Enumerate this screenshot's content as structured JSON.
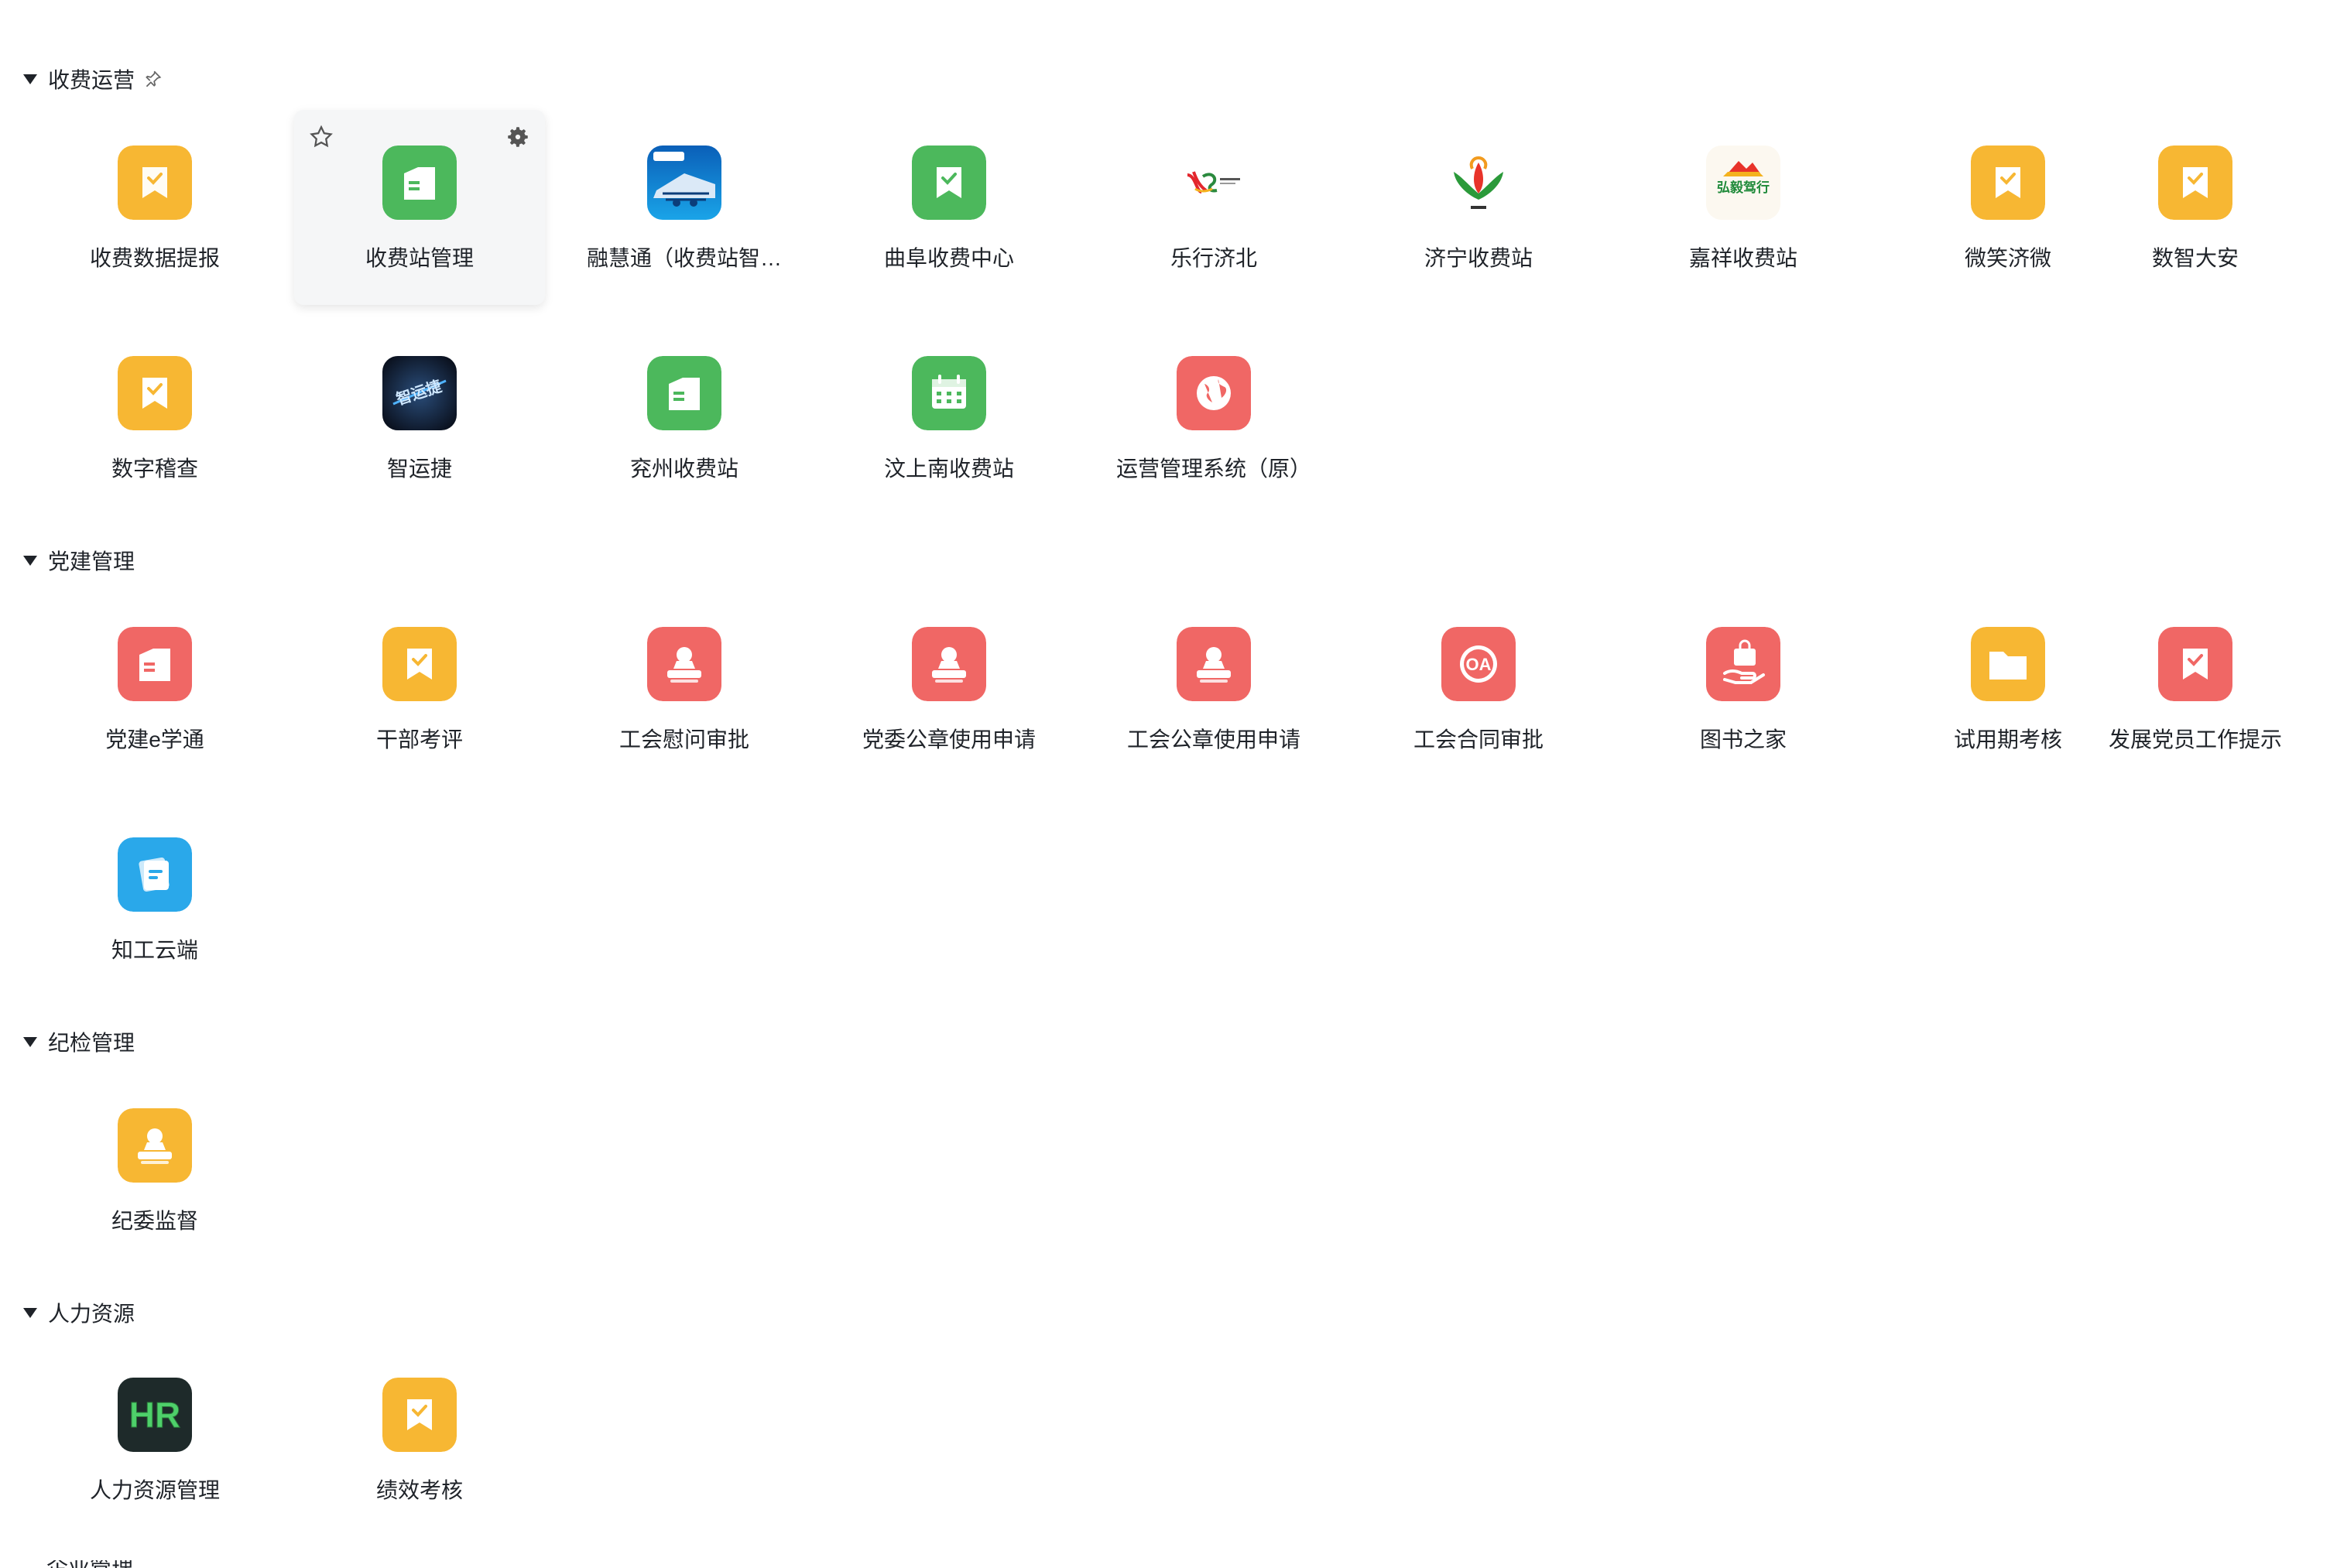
{
  "colors": {
    "orange": "#f7b733",
    "green": "#4cb85c",
    "red": "#f06765",
    "blue": "#2aa8ea",
    "text": "#1f2329"
  },
  "sections": [
    {
      "title": "收费运营",
      "pinned": true,
      "apps": [
        {
          "label": "收费数据提报",
          "icon": "orange-bookmark-check-icon"
        },
        {
          "label": "收费站管理",
          "icon": "green-document-icon"
        },
        {
          "label": "融慧通（收费站智…",
          "icon": "toll-station-photo-icon"
        },
        {
          "label": "曲阜收费中心",
          "icon": "green-bookmark-check-icon"
        },
        {
          "label": "乐行济北",
          "icon": "lexing-jibei-logo-icon"
        },
        {
          "label": "济宁收费站",
          "icon": "jining-flower-logo-icon"
        },
        {
          "label": "嘉祥收费站",
          "icon": "hongyi-logo-icon"
        },
        {
          "label": "微笑济微",
          "icon": "orange-bookmark-check-icon"
        },
        {
          "label": "数智大安",
          "icon": "orange-bookmark-check-icon"
        },
        {
          "label": "数字稽查",
          "icon": "orange-bookmark-check-icon"
        },
        {
          "label": "智运捷",
          "icon": "zhiyunjie-dark-logo-icon"
        },
        {
          "label": "兖州收费站",
          "icon": "green-document-icon"
        },
        {
          "label": "汶上南收费站",
          "icon": "green-calendar-icon"
        },
        {
          "label": "运营管理系统（原）",
          "icon": "red-globe-icon"
        }
      ]
    },
    {
      "title": "党建管理",
      "pinned": false,
      "apps": [
        {
          "label": "党建e学通",
          "icon": "red-document-icon"
        },
        {
          "label": "干部考评",
          "icon": "orange-bookmark-check-icon"
        },
        {
          "label": "工会慰问审批",
          "icon": "red-stamp-icon"
        },
        {
          "label": "党委公章使用申请",
          "icon": "red-stamp-icon"
        },
        {
          "label": "工会公章使用申请",
          "icon": "red-stamp-icon"
        },
        {
          "label": "工会合同审批",
          "icon": "red-oa-icon"
        },
        {
          "label": "图书之家",
          "icon": "red-hand-bag-icon"
        },
        {
          "label": "试用期考核",
          "icon": "orange-folder-icon"
        },
        {
          "label": "发展党员工作提示",
          "icon": "red-bookmark-check-icon"
        },
        {
          "label": "知工云端",
          "icon": "blue-notes-icon"
        }
      ]
    },
    {
      "title": "纪检管理",
      "pinned": false,
      "apps": [
        {
          "label": "纪委监督",
          "icon": "orange-stamp-icon"
        }
      ]
    },
    {
      "title": "人力资源",
      "pinned": false,
      "apps": [
        {
          "label": "人力资源管理",
          "icon": "hr-logo-icon"
        },
        {
          "label": "绩效考核",
          "icon": "orange-bookmark-check-icon"
        }
      ]
    }
  ],
  "logos": {
    "zhiyunjie": "智运捷",
    "hongyi": "弘毅驾行",
    "hr": "HR",
    "oa": "OA"
  },
  "partial_section_title": "企业管理"
}
